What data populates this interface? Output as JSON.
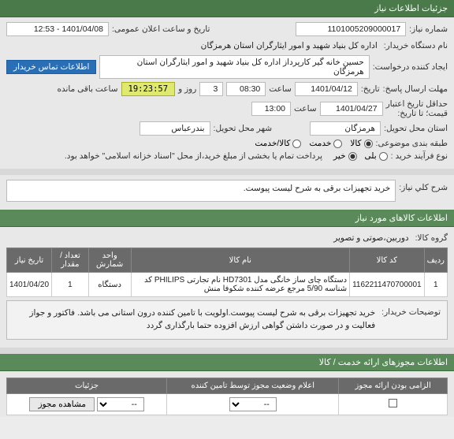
{
  "header": {
    "title": "جزئیات اطلاعات نیاز"
  },
  "info": {
    "req_no_lbl": "شماره نیاز:",
    "req_no": "1101005209000017",
    "pub_date_lbl": "تاریخ و ساعت اعلان عمومی:",
    "pub_date": "1401/04/08 - 12:53",
    "buyer_lbl": "نام دستگاه خریدار:",
    "buyer": "اداره کل بنیاد شهید و امور ایثارگران استان هرمزگان",
    "requester_lbl": "ایجاد کننده درخواست:",
    "requester": "حسین خانه گیر کارپرداز اداره کل بنیاد شهید و امور ایثارگران استان هرمزگان",
    "contact_btn": "اطلاعات تماس خریدار",
    "deadline_lbl": "مهلت ارسال پاسخ:",
    "deadline_until": "تاریخ:",
    "deadline_date": "1401/04/12",
    "deadline_time_lbl": "ساعت",
    "deadline_time": "08:30",
    "days_lbl": "روز و",
    "days": "3",
    "countdown": "19:23:57",
    "remain_lbl": "ساعت باقی مانده",
    "validity_lbl": "حداقل تاریخ اعتبار",
    "validity_lbl2": "قیمت؛ تا تاریخ:",
    "validity_date": "1401/04/27",
    "validity_time_lbl": "ساعت",
    "validity_time": "13:00",
    "province_lbl": "استان محل تحویل:",
    "province": "هرمزگان",
    "city_lbl": "شهر محل تحویل:",
    "city": "بندرعباس",
    "cat_lbl": "طبقه بندی موضوعی:",
    "cat_opts": {
      "a": "کالا",
      "b": "خدمت",
      "c": "کالا/خدمت"
    },
    "buy_type_lbl": "نوع فرآیند خرید :",
    "buy_type_opts": {
      "a": "بلی",
      "b": "خیر"
    },
    "buy_type_note": "پرداخت تمام یا بخشی از مبلغ خرید،از محل \"اسناد خزانه اسلامی\" خواهد بود."
  },
  "desc": {
    "title_lbl": "شرح کلي نياز:",
    "title": "خرید تجهیزات برقی به شرح لیست پیوست.",
    "items_header": "اطلاعات کالاهای مورد نیاز",
    "group_lbl": "گروه کالا:",
    "group": "دوربین،صوتی و تصویر"
  },
  "table": {
    "cols": {
      "row": "رديف",
      "code": "کد کالا",
      "name": "نام کالا",
      "unit": "واحد شمارش",
      "qty": "تعداد / مقدار",
      "date": "تاریخ نیاز"
    },
    "rows": [
      {
        "row": "1",
        "code": "1162211470700001",
        "name": "دستگاه چای ساز خانگی مدل HD7301 نام تجارتی PHILIPS کد شناسه 5/90 مرجع عرضه کننده شکوفا منش",
        "unit": "دستگاه",
        "qty": "1",
        "date": "1401/04/20"
      }
    ]
  },
  "notes": {
    "lbl": "توضیحات خریدار:",
    "text": "خرید تجهیزات برقی به شرح لیست پیوست.اولویت با تامین کننده درون استانی می باشد. فاکتور و جواز فعالیت و در صورت داشتن گواهی ارزش افزوده حتما بارگذاری گردد"
  },
  "permits": {
    "header": "اطلاعات مجوزهای ارائه خدمت / کالا",
    "cols": {
      "mandatory": "الزامی بودن ارائه مجوز",
      "status": "اعلام وضعیت مجوز توسط تامین کننده",
      "details": "جزئیات"
    },
    "row": {
      "status_sel": "--",
      "details_sel": "--",
      "view_btn": "مشاهده مجوز"
    }
  }
}
